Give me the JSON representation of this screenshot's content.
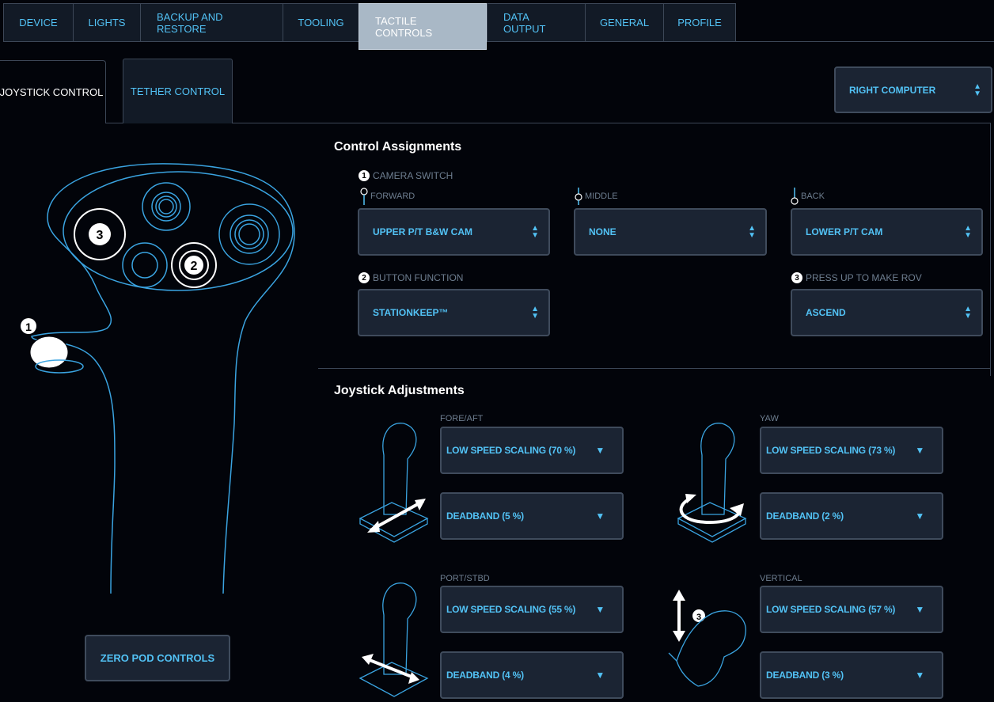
{
  "top_tabs": [
    {
      "label": "DEVICE"
    },
    {
      "label": "LIGHTS"
    },
    {
      "label": "BACKUP AND RESTORE"
    },
    {
      "label": "TOOLING"
    },
    {
      "label": "TACTILE CONTROLS"
    },
    {
      "label": "DATA OUTPUT"
    },
    {
      "label": "GENERAL"
    },
    {
      "label": "PROFILE"
    }
  ],
  "sub_tabs": {
    "joystick": "JOYSTICK CONTROL",
    "tether": "TETHER CONTROL"
  },
  "computer_select": "RIGHT COMPUTER",
  "control_assignments": {
    "title": "Control Assignments",
    "camera_switch": {
      "badge": "1",
      "label": "CAMERA SWITCH",
      "forward": {
        "label": "FORWARD",
        "value": "UPPER P/T B&W CAM"
      },
      "middle": {
        "label": "MIDDLE",
        "value": "NONE"
      },
      "back": {
        "label": "BACK",
        "value": "LOWER P/T CAM"
      }
    },
    "button_function": {
      "badge": "2",
      "label": "BUTTON FUNCTION",
      "value": "STATIONKEEP™"
    },
    "press_up": {
      "badge": "3",
      "label": "PRESS UP TO MAKE ROV",
      "value": "ASCEND"
    }
  },
  "joystick_adjustments": {
    "title": "Joystick Adjustments",
    "fore_aft": {
      "label": "FORE/AFT",
      "scaling": "LOW SPEED SCALING (70 %)",
      "deadband": "DEADBAND (5 %)"
    },
    "yaw": {
      "label": "YAW",
      "scaling": "LOW SPEED SCALING (73 %)",
      "deadband": "DEADBAND (2 %)"
    },
    "port_stbd": {
      "label": "PORT/STBD",
      "scaling": "LOW SPEED SCALING (55 %)",
      "deadband": "DEADBAND (4 %)"
    },
    "vertical": {
      "label": "VERTICAL",
      "scaling": "LOW SPEED SCALING (57 %)",
      "deadband": "DEADBAND (3 %)"
    }
  },
  "diagram_badges": {
    "one": "1",
    "two": "2",
    "three": "3"
  },
  "zero_button": "ZERO POD CONTROLS",
  "icons": {
    "spinner": "up-down-arrows",
    "caret": "down-triangle"
  },
  "colors": {
    "accent": "#52c2f5",
    "background": "#02040a",
    "panel": "#1b2433",
    "active_tab": "#a9b8c6"
  }
}
